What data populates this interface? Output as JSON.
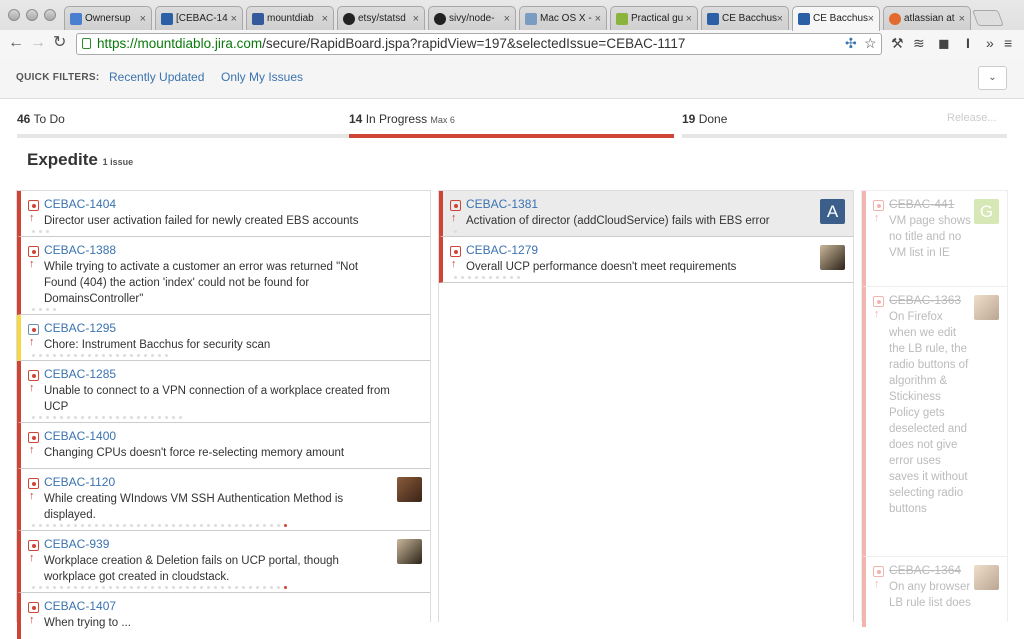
{
  "browser": {
    "tabs": [
      {
        "label": "Ownersup",
        "color": "#4a7fd0"
      },
      {
        "label": "[CEBAC-14",
        "color": "#2b5fa6"
      },
      {
        "label": "mountdiab",
        "color": "#345a9c"
      },
      {
        "label": "etsy/statsd",
        "color": "#222222"
      },
      {
        "label": "sivy/node-",
        "color": "#222222"
      },
      {
        "label": "Mac OS X -",
        "color": "#7a9cc2"
      },
      {
        "label": "Practical gu",
        "color": "#8ab43c"
      },
      {
        "label": "CE Bacchus",
        "color": "#2b5fa6"
      },
      {
        "label": "CE Bacchus",
        "color": "#2b5fa6"
      },
      {
        "label": "atlassian at",
        "color": "#e26a2c"
      }
    ],
    "url_host": "https://mountdiablo.jira.com",
    "url_path": "/secure/RapidBoard.jspa?rapidView=197&selectedIssue=CEBAC-1117"
  },
  "quick_filters": {
    "label": "QUICK FILTERS:",
    "recently_updated": "Recently Updated",
    "only_my_issues": "Only My Issues"
  },
  "columns": {
    "todo": {
      "count": "46",
      "name": "To Do"
    },
    "inprogress": {
      "count": "14",
      "name": "In Progress",
      "max": "Max 6"
    },
    "done": {
      "count": "19",
      "name": "Done",
      "release": "Release..."
    }
  },
  "swimlane": {
    "title": "Expedite",
    "count": "1 issue"
  },
  "todo_cards": [
    {
      "key": "CEBAC-1404",
      "summary": "Director user activation failed for newly created EBS accounts"
    },
    {
      "key": "CEBAC-1388",
      "summary": "While trying to activate a customer an error was returned \"Not Found (404) the action 'index' could not be found for DomainsController\""
    },
    {
      "key": "CEBAC-1295",
      "summary": "Chore: Instrument Bacchus for security scan"
    },
    {
      "key": "CEBAC-1285",
      "summary": "Unable to connect to a VPN connection of a workplace created from UCP"
    },
    {
      "key": "CEBAC-1400",
      "summary": "Changing CPUs doesn't force re-selecting memory amount"
    },
    {
      "key": "CEBAC-1120",
      "summary": "While creating WIndows VM SSH Authentication Method is displayed."
    },
    {
      "key": "CEBAC-939",
      "summary": "Workplace creation & Deletion fails on UCP portal, though workplace got created in cloudstack."
    },
    {
      "key": "CEBAC-1407",
      "summary": "When trying to ..."
    }
  ],
  "inprogress_cards": [
    {
      "key": "CEBAC-1381",
      "summary": "Activation of director (addCloudService) fails with EBS error",
      "avatar": "A"
    },
    {
      "key": "CEBAC-1279",
      "summary": "Overall UCP performance doesn't meet requirements"
    }
  ],
  "done_cards": [
    {
      "key": "CEBAC-441",
      "summary": "VM page shows no title and no VM list in IE",
      "avatar": "G"
    },
    {
      "key": "CEBAC-1363",
      "summary": "On Firefox when we edit the LB rule, the radio buttons of algorithm & Stickiness Policy gets deselected and does not give error uses saves it without selecting radio buttons"
    },
    {
      "key": "CEBAC-1364",
      "summary": "On any browser LB rule list does"
    }
  ]
}
